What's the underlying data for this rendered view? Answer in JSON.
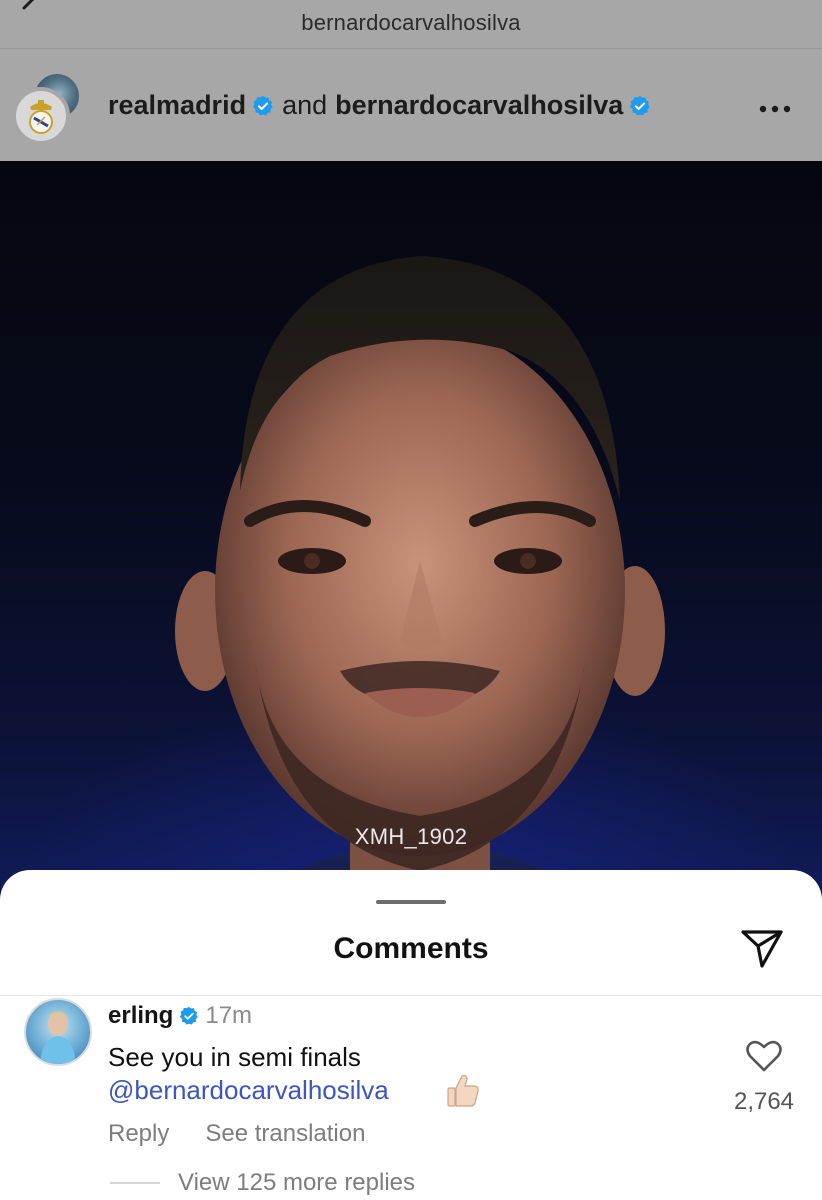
{
  "topbar": {
    "title": "bernardocarvalhosilva"
  },
  "post": {
    "author_primary": "realmadrid",
    "conjunction": "and",
    "author_secondary": "bernardocarvalhosilva",
    "verified_color": "#1d9bf0",
    "icons": {
      "back": "back-arrow-icon",
      "more": "more-icon",
      "crest": "real-madrid-crest-icon"
    }
  },
  "media": {
    "watermark": "XMH_1902"
  },
  "comments": {
    "title": "Comments",
    "items": [
      {
        "user": "erling",
        "verified": true,
        "time": "17m",
        "text": "See you in semi finals",
        "mention": "@bernardocarvalhosilva",
        "emoji": "thumbs-up",
        "likes": "2,764",
        "reply_label": "Reply",
        "translate_label": "See translation",
        "view_replies": "View 125 more replies"
      }
    ]
  },
  "colors": {
    "mention": "#3b56c4",
    "muted": "#7d7d7d",
    "overlay": "#a7a7a7"
  }
}
